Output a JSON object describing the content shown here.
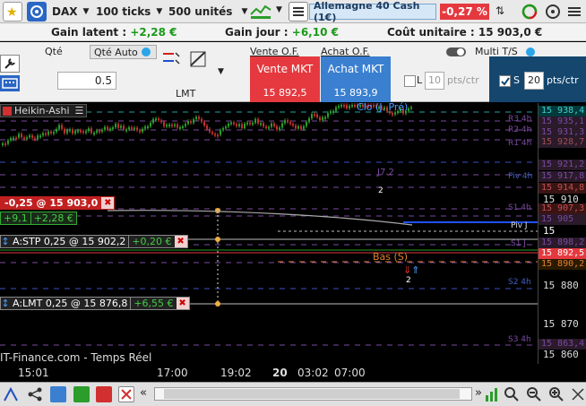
{
  "toolbar": {
    "instrument": "DAX",
    "ticks": "100 ticks",
    "units": "500 unités",
    "market": "Allemagne 40 Cash (1€)",
    "change": "-0,27 %"
  },
  "gains": {
    "latent_label": "Gain latent : ",
    "latent_value": "+2,28 €",
    "day_label": "Gain jour : ",
    "day_value": "+6,10 €",
    "unit_cost": "Coût unitaire : 15 903,0 €"
  },
  "orderpanel": {
    "qty_label": "Qté",
    "qty_auto": "Qté Auto",
    "qty_value": "0.5",
    "order_type": "LMT",
    "sell_header": "Vente O.F.",
    "buy_header": "Achat O.F.",
    "multi_ts": "Multi T/S",
    "sell_label": "Vente MKT",
    "sell_price": "15 892,5",
    "buy_label": "Achat MKT",
    "buy_price": "15 893,9",
    "l_label": "L",
    "l_value": "10",
    "l_unit": "pts/ctr",
    "s_label": "S",
    "s_value": "20",
    "s_unit": "pts/ctr"
  },
  "chart": {
    "chart_type": "Heikin-Ashi",
    "clo_label": "Clo (J. Pré)",
    "bas_label": "Bas (S)",
    "source": "IT-Finance.com - Temps Réel",
    "pivots": [
      "S3 4h",
      "S2 4h",
      "S1 4h",
      "Piv 4h",
      "R1 4h",
      "R2 4h",
      "R3 4h",
      "Piv J",
      "S1 J",
      "J7.2"
    ],
    "arrow_count_top": "2",
    "arrow_count_bottom": "2"
  },
  "orders": {
    "position": "-0,25 @ 15 903,0",
    "position_pnl1": "+9,1",
    "position_pnl2": "+2,28 €",
    "stp": "A:STP  0,25 @ 15 902,2",
    "stp_pnl": "+0,20 €",
    "lmt": "A:LMT  0,25 @ 15 876,8",
    "lmt_pnl": "+6,55 €"
  },
  "price_axis": {
    "labels": [
      "15 938,4",
      "15 935,1",
      "15 931,3",
      "15 928,7",
      "15 921,2",
      "15 917,8",
      "15 914,8",
      "15 910",
      "15 907,3",
      "15 905",
      "15 899,9",
      "15 898,2",
      "15 892,5",
      "15 890,2",
      "15 880",
      "15 870",
      "15 863,4",
      "15 860"
    ]
  },
  "time_axis": {
    "labels": [
      "15:01",
      "17:00",
      "19:02",
      "20",
      "03:02",
      "07:00"
    ]
  }
}
